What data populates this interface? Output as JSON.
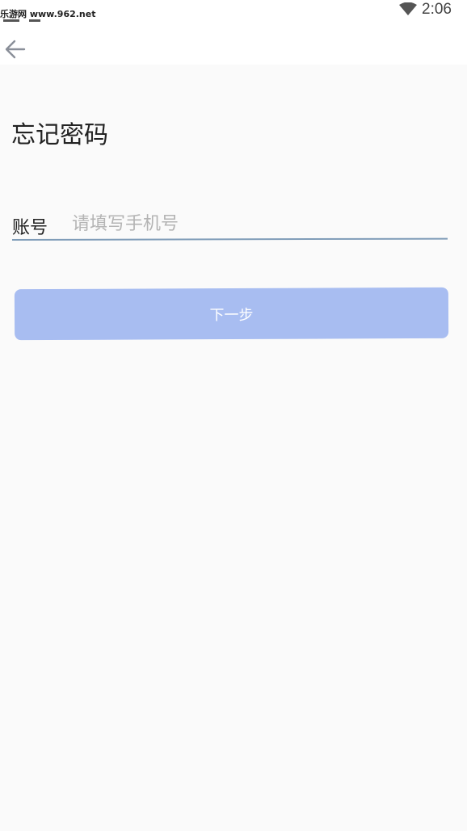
{
  "status_bar": {
    "watermark": "乐游网 www.962.net",
    "time": "2:06",
    "icons": [
      "wifi-icon"
    ]
  },
  "app_bar": {
    "back_icon": "arrow-left-icon"
  },
  "page": {
    "title": "忘记密码"
  },
  "form": {
    "account_label": "账号",
    "account_value": "",
    "account_placeholder": "请填写手机号",
    "next_label": "下一步"
  },
  "colors": {
    "background": "#fafafa",
    "button": "#a8bdf1",
    "underline": "#7f9cb8",
    "placeholder": "#b4b4b4"
  }
}
